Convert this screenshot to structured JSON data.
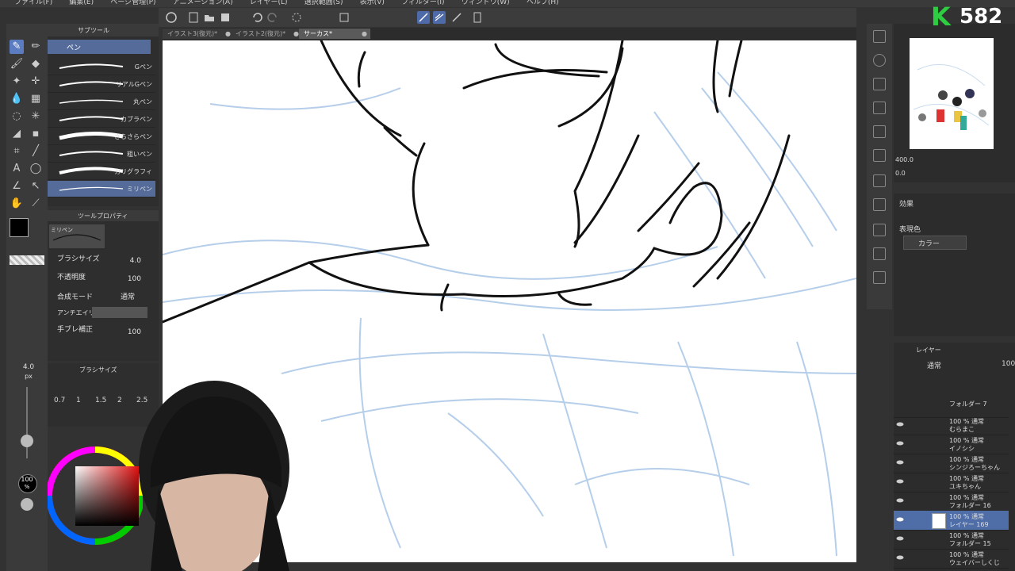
{
  "menu": [
    "ファイル(F)",
    "編集(E)",
    "ページ管理(P)",
    "アニメーション(A)",
    "レイヤー(L)",
    "選択範囲(S)",
    "表示(V)",
    "フィルター(I)",
    "ウィンドウ(W)",
    "ヘルプ(H)"
  ],
  "tabs": [
    {
      "label": "イラスト3(復元)*",
      "active": false
    },
    {
      "label": "イラスト2(復元)*",
      "active": false
    },
    {
      "label": "サーカス*",
      "active": true
    }
  ],
  "subtool": {
    "header": "サブツール",
    "group": "ペン",
    "brushes": [
      "Gペン",
      "リアルGペン",
      "丸ペン",
      "カブラペン",
      "さらさらペン",
      "粗いペン",
      "カリグラフィ",
      "ミリペン"
    ],
    "selected_index": 7
  },
  "tool_property": {
    "header": "ツールプロパティ",
    "preset": "ミリペン",
    "rows": [
      {
        "label": "ブラシサイズ",
        "value": "4.0"
      },
      {
        "label": "不透明度",
        "value": "100"
      },
      {
        "label": "合成モード",
        "value": "通常"
      },
      {
        "label": "アンチエイリアス",
        "value": ""
      },
      {
        "label": "手ブレ補正",
        "value": "100"
      }
    ]
  },
  "brush_size_panel": {
    "header": "ブラシサイズ",
    "current": "4.0",
    "unit": "px",
    "presets": [
      "0.7",
      "1",
      "1.5",
      "2",
      "2.5"
    ]
  },
  "opacity_readout": "100",
  "opacity_unit": "%",
  "navigator": {
    "zoom": "400.0",
    "angle": "0.0"
  },
  "effects": {
    "label": "効果",
    "expression_color_label": "表現色",
    "expression_color_value": "カラー"
  },
  "layers": {
    "header": "レイヤー",
    "blend": "通常",
    "opacity": "100",
    "items": [
      {
        "line1": "フォルダー 7",
        "line2": "",
        "selected": false
      },
      {
        "line1": "100 % 通常",
        "line2": "むらまこ",
        "selected": false
      },
      {
        "line1": "100 % 通常",
        "line2": "イノシシ",
        "selected": false
      },
      {
        "line1": "100 % 通常",
        "line2": "シンジろーちゃん",
        "selected": false
      },
      {
        "line1": "100 % 通常",
        "line2": "ユキちゃん",
        "selected": false
      },
      {
        "line1": "100 % 通常",
        "line2": "フォルダー 16",
        "selected": false
      },
      {
        "line1": "100 % 通常",
        "line2": "レイヤー 169",
        "selected": true
      },
      {
        "line1": "100 % 通常",
        "line2": "フォルダー 15",
        "selected": false
      },
      {
        "line1": "100 % 通常",
        "line2": "ウェイバーしくじ",
        "selected": false
      }
    ]
  },
  "score": {
    "letter": "K",
    "value": "582"
  },
  "colors": {
    "accent": "#5b7cc0",
    "selected_layer": "#4f6ea8",
    "sketch_blue": "#aec9e8",
    "k_green": "#2ecc40"
  }
}
